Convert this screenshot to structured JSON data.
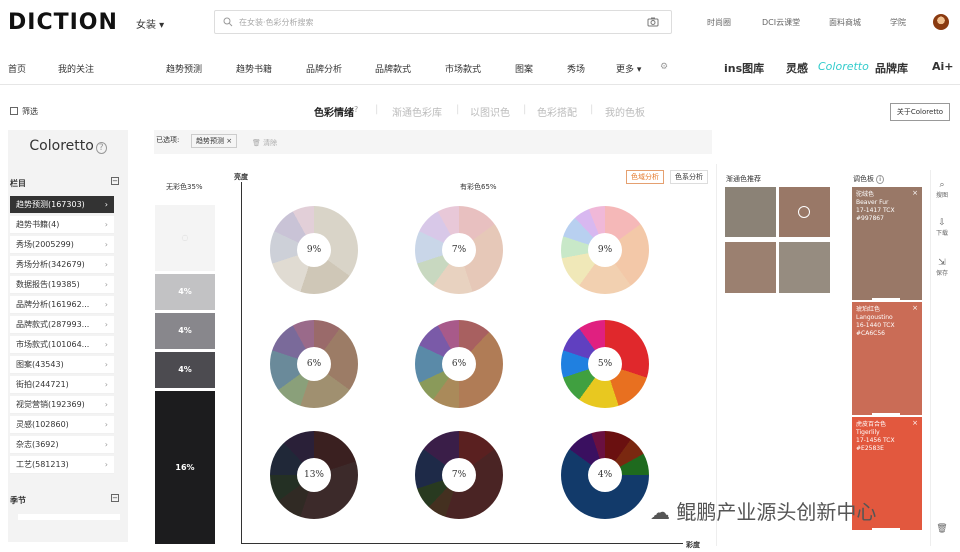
{
  "header": {
    "logo": "DICTION",
    "category": "女装 ▾",
    "search_placeholder": "在女装·色彩分析搜索",
    "links": [
      "时尚圈",
      "DCI云课堂",
      "面料商城",
      "学院"
    ]
  },
  "nav": {
    "items": [
      "首页",
      "我的关注",
      "趋势预测",
      "趋势书籍",
      "品牌分析",
      "品牌款式",
      "市场款式",
      "图案",
      "秀场",
      "更多 ▾"
    ],
    "brands": [
      "ins图库",
      "灵感",
      "Coloretto",
      "品牌库",
      "Ai+"
    ]
  },
  "filter_label": "筛选",
  "tabs": [
    "色彩情绪",
    "渐通色彩库",
    "以图识色",
    "色彩搭配",
    "我的色板"
  ],
  "active_tab": "色彩情绪",
  "about_button": "关于Coloretto",
  "sidebar": {
    "title": "Coloretto",
    "section1": "栏目",
    "items": [
      {
        "label": "趋势预测(167303)",
        "active": true
      },
      {
        "label": "趋势书籍(4)"
      },
      {
        "label": "秀场(2005299)"
      },
      {
        "label": "秀场分析(342679)"
      },
      {
        "label": "数据报告(19385)"
      },
      {
        "label": "品牌分析(161962..."
      },
      {
        "label": "品牌款式(287993..."
      },
      {
        "label": "市场款式(101064..."
      },
      {
        "label": "图案(43543)"
      },
      {
        "label": "街拍(244721)"
      },
      {
        "label": "视觉营销(192369)"
      },
      {
        "label": "灵感(102860)"
      },
      {
        "label": "杂志(3692)"
      },
      {
        "label": "工艺(581213)"
      }
    ],
    "section2": "季节"
  },
  "selection": {
    "label": "已选项:",
    "chip": "趋势预测 ×",
    "clear": "清除"
  },
  "chart": {
    "achromatic_label": "无彩色35%",
    "chromatic_label": "有彩色65%",
    "y_axis": "亮度",
    "x_axis": "彩度",
    "toggle_on": "色域分析",
    "toggle_off": "色系分析",
    "bars": [
      {
        "label": "",
        "color": "#f4f4f4"
      },
      {
        "label": "4%",
        "color": "#c2c2c4"
      },
      {
        "label": "4%",
        "color": "#88878c"
      },
      {
        "label": "4%",
        "color": "#4c4b50"
      },
      {
        "label": "16%",
        "color": "#1c1c1e"
      }
    ],
    "donuts": [
      "9%",
      "7%",
      "9%",
      "6%",
      "6%",
      "5%",
      "13%",
      "7%",
      "4%"
    ]
  },
  "recommend": {
    "title": "渐通色推荐",
    "swatches": [
      "#8b8276",
      "#997867",
      "#9b8070",
      "#968c80"
    ]
  },
  "palette": {
    "title": "调色板",
    "cards": [
      {
        "name": "驼绒色",
        "en": "Beaver Fur",
        "code": "17-1417 TCX",
        "hex": "#997867",
        "color": "#997867"
      },
      {
        "name": "琥珀红色",
        "en": "Langoustino",
        "code": "16-1440 TCX",
        "hex": "#CA6C56",
        "color": "#ca6c56"
      },
      {
        "name": "虎皮百合色",
        "en": "Tigerlily",
        "code": "17-1456 TCX",
        "hex": "#E2583E",
        "color": "#e2583e"
      }
    ]
  },
  "tools": [
    "搜图",
    "下载",
    "保存"
  ],
  "watermark": "鲲鹏产业源头创新中心"
}
